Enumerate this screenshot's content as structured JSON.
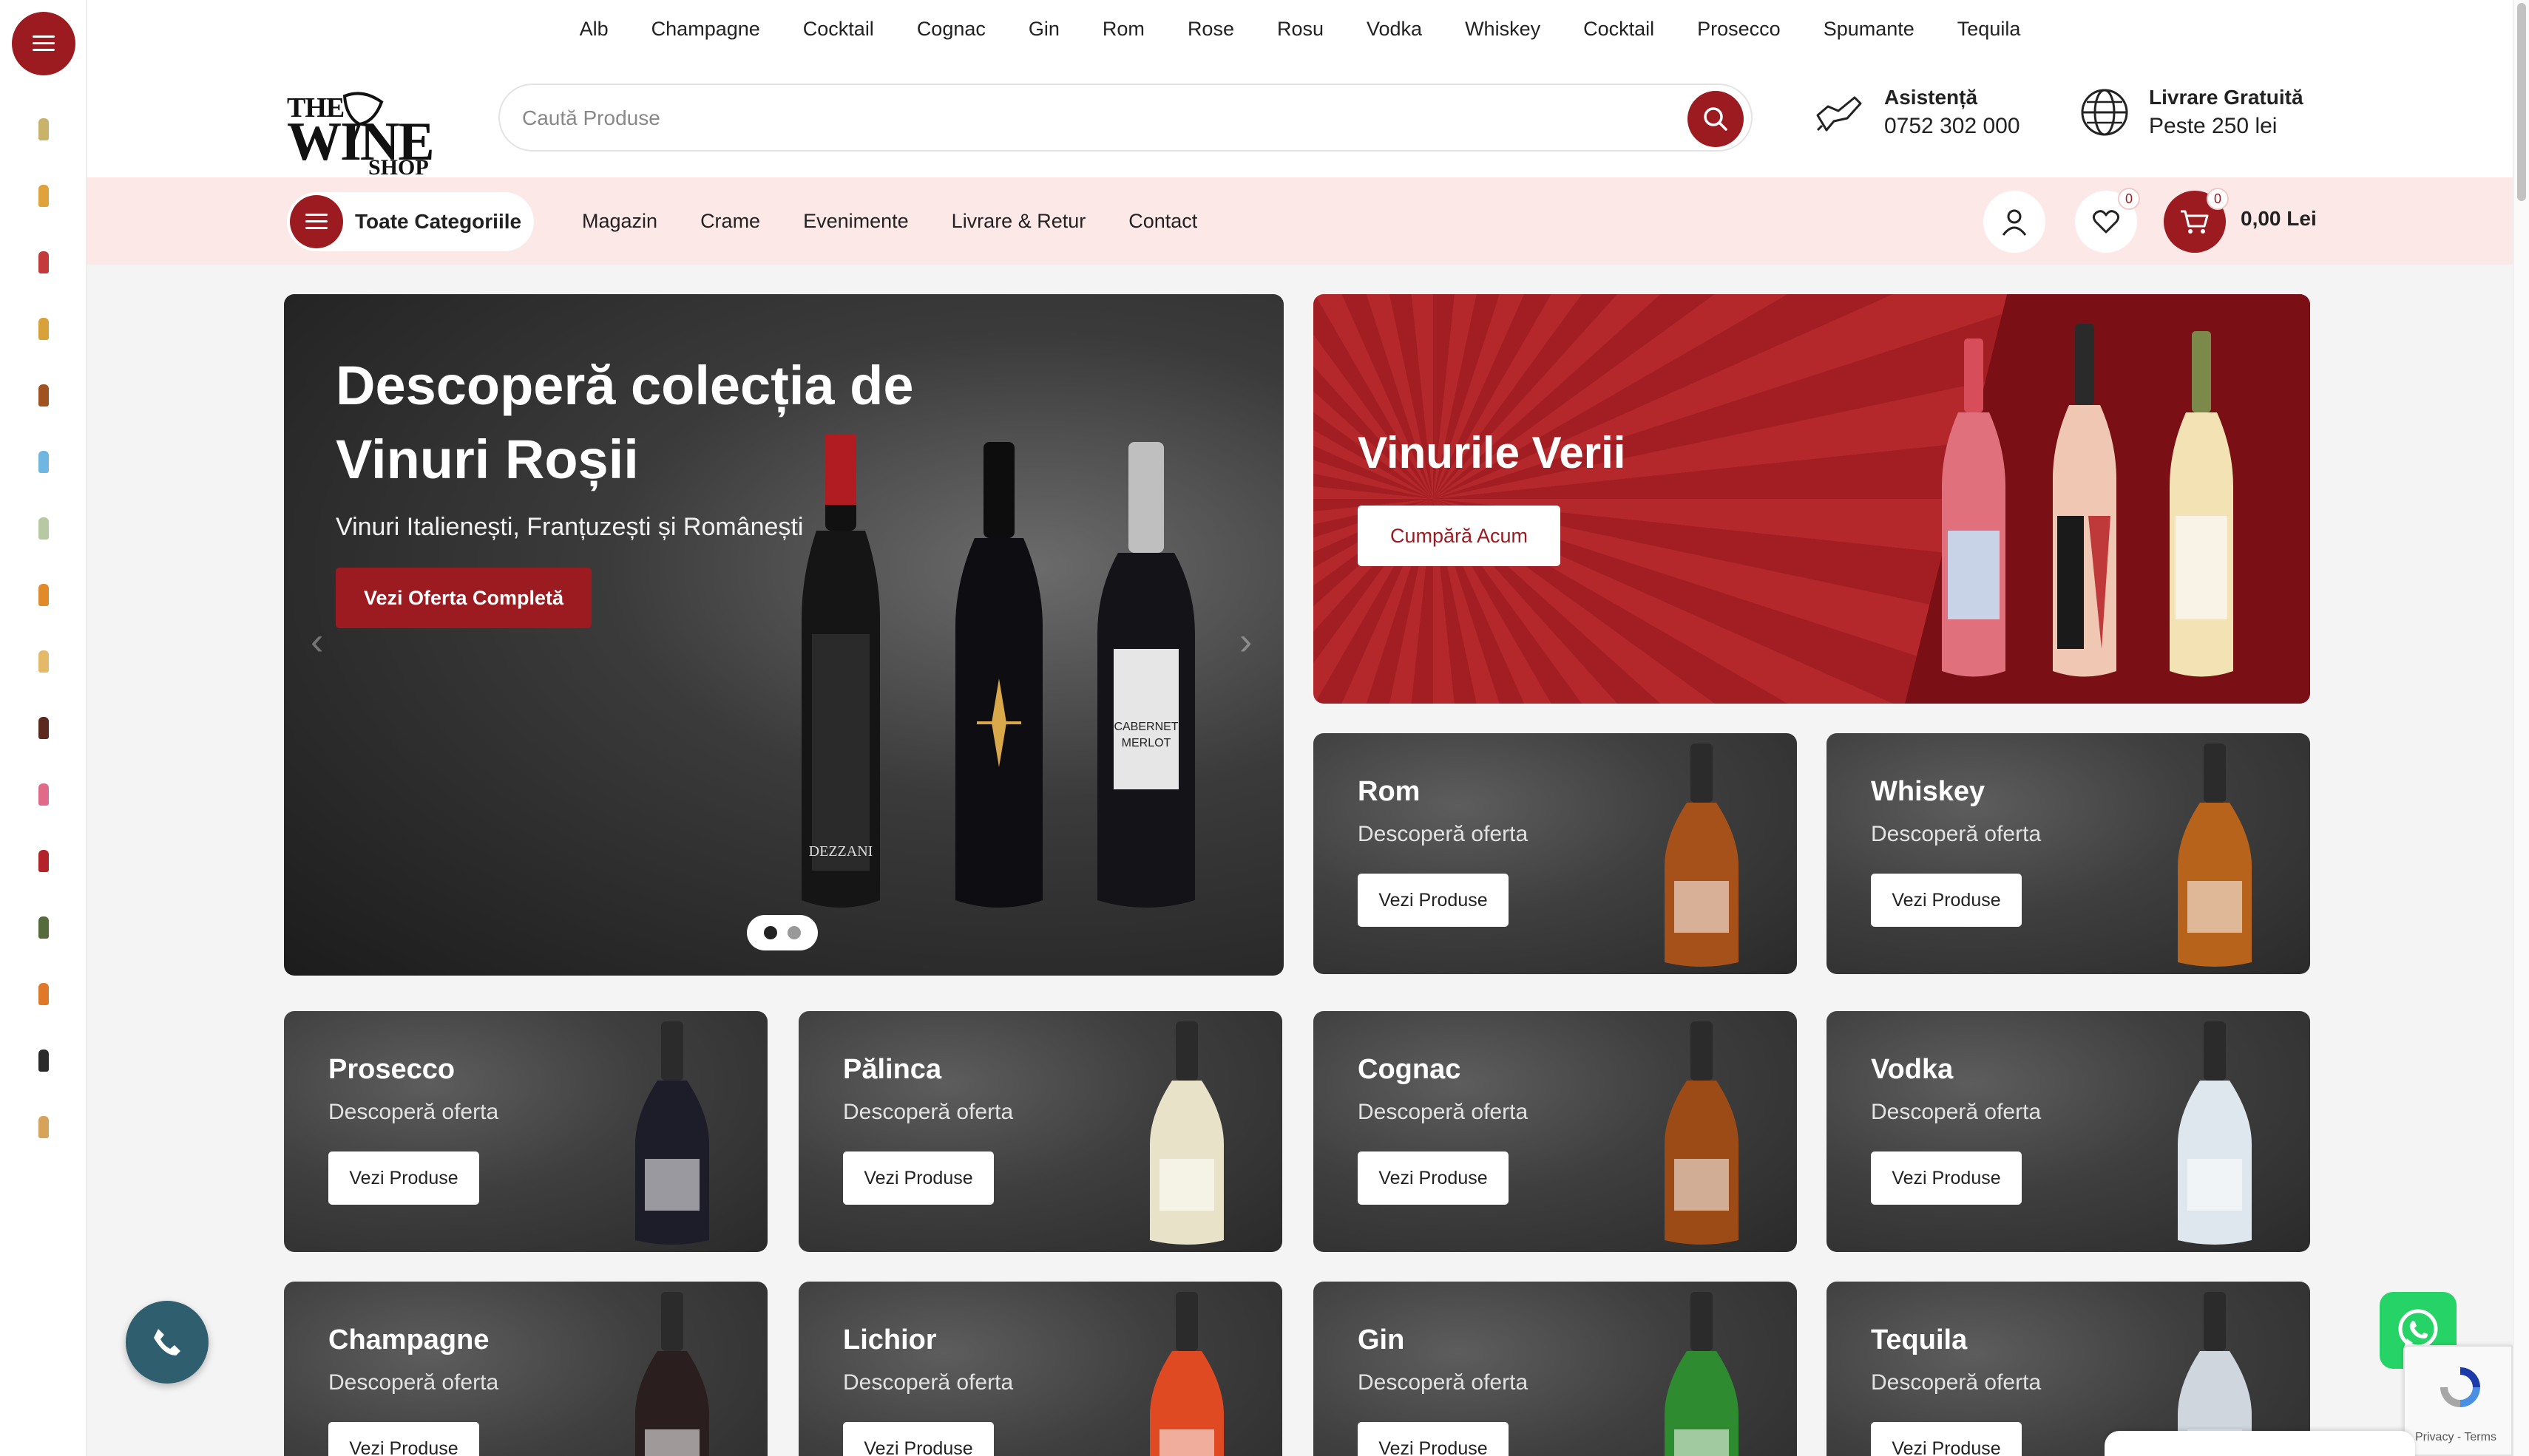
{
  "top_categories": [
    "Alb",
    "Champagne",
    "Cocktail",
    "Cognac",
    "Gin",
    "Rom",
    "Rose",
    "Rosu",
    "Vodka",
    "Whiskey",
    "Cocktail",
    "Prosecco",
    "Spumante",
    "Tequila"
  ],
  "logo": {
    "line1": "THE",
    "line2": "WINE",
    "line3": "SHOP"
  },
  "search": {
    "placeholder": "Caută Produse"
  },
  "support": {
    "title": "Asistență",
    "phone": "0752 302 000"
  },
  "delivery": {
    "title": "Livrare Gratuită",
    "subtitle": "Peste 250 lei"
  },
  "nav": {
    "all_categories": "Toate Categoriile",
    "links": [
      "Magazin",
      "Crame",
      "Evenimente",
      "Livrare & Retur",
      "Contact"
    ],
    "wishlist_count": "0",
    "cart_count": "0",
    "cart_total": "0,00 Lei"
  },
  "hero": {
    "title": "Descoperă colecția de Vinuri Roșii",
    "subtitle": "Vinuri Italienești, Franțuzești și Românești",
    "cta": "Vezi Oferta Completă",
    "slide_count": 2,
    "active_slide": 1
  },
  "summer": {
    "title": "Vinurile Verii",
    "cta": "Cumpără Acum"
  },
  "cards": [
    {
      "name": "Rom",
      "subtitle": "Descoperă oferta",
      "button": "Vezi Produse",
      "bottle_color": "#a6511a"
    },
    {
      "name": "Whiskey",
      "subtitle": "Descoperă oferta",
      "button": "Vezi Produse",
      "bottle_color": "#b8631b"
    },
    {
      "name": "Prosecco",
      "subtitle": "Descoperă oferta",
      "button": "Vezi Produse",
      "bottle_color": "#1d1d2a"
    },
    {
      "name": "Pălinca",
      "subtitle": "Descoperă oferta",
      "button": "Vezi Produse",
      "bottle_color": "#e8e3c8"
    },
    {
      "name": "Cognac",
      "subtitle": "Descoperă oferta",
      "button": "Vezi Produse",
      "bottle_color": "#9c4a16"
    },
    {
      "name": "Vodka",
      "subtitle": "Descoperă oferta",
      "button": "Vezi Produse",
      "bottle_color": "#dfe7ee"
    },
    {
      "name": "Champagne",
      "subtitle": "Descoperă oferta",
      "button": "Vezi Produse",
      "bottle_color": "#2a1e1e"
    },
    {
      "name": "Lichior",
      "subtitle": "Descoperă oferta",
      "button": "Vezi Produse",
      "bottle_color": "#e04a22"
    },
    {
      "name": "Gin",
      "subtitle": "Descoperă oferta",
      "button": "Vezi Produse",
      "bottle_color": "#2f8b2f"
    },
    {
      "name": "Tequila",
      "subtitle": "Descoperă oferta",
      "button": "Vezi Produse",
      "bottle_color": "#cfd6de"
    }
  ],
  "sidebar_icons": [
    {
      "name": "wine-glass-icon",
      "color": "#c9b26a"
    },
    {
      "name": "beer-icon",
      "color": "#e0a23a"
    },
    {
      "name": "red-bottle-icon",
      "color": "#c43a3a"
    },
    {
      "name": "cocktail-icon",
      "color": "#d9a13a"
    },
    {
      "name": "cognac-icon",
      "color": "#a0521f"
    },
    {
      "name": "blue-glass-icon",
      "color": "#6fb6e0"
    },
    {
      "name": "prosecco-glass-icon",
      "color": "#b7c9a2"
    },
    {
      "name": "whiskey-bottle-icon",
      "color": "#e08a2a"
    },
    {
      "name": "champagne-glass-icon",
      "color": "#e3b96a"
    },
    {
      "name": "dark-bottle-icon",
      "color": "#5a2a1e"
    },
    {
      "name": "rose-glass-icon",
      "color": "#e06a8a"
    },
    {
      "name": "red-wine-glass-icon",
      "color": "#b3242a"
    },
    {
      "name": "green-bottle-icon",
      "color": "#556b3a"
    },
    {
      "name": "orange-bottle-icon",
      "color": "#e0782a"
    },
    {
      "name": "black-bottle-icon",
      "color": "#2a2a2a"
    },
    {
      "name": "glass-set-icon",
      "color": "#d7a35a"
    }
  ],
  "recaptcha": {
    "terms": "Privacy - Terms"
  },
  "colors": {
    "brand": "#9b1b20",
    "nav_bg": "#fde8e8"
  }
}
